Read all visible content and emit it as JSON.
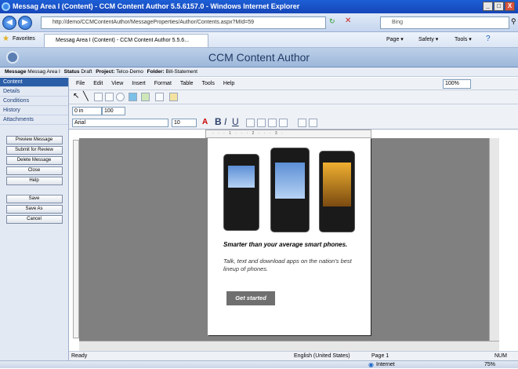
{
  "window": {
    "title": "Messag Area I (Content) - CCM Content Author 5.5.6157.0 - Windows Internet Explorer",
    "min": "_",
    "max": "□",
    "close": "X"
  },
  "browser": {
    "url": "http://demo/CCMContentAuthor/MessageProperties/Author/Contents.aspx?MId=59",
    "search_placeholder": "Bing",
    "favorites": "Favorites",
    "tab": "Messag Area I (Content) - CCM Content Author 5.5.6...",
    "page_menu": "Page ▾",
    "safety_menu": "Safety ▾",
    "tools_menu": "Tools ▾"
  },
  "app": {
    "title": "CCM Content Author"
  },
  "info": {
    "message_label": "Message",
    "message_value": "Messag Area I",
    "status_label": "Status",
    "status_value": "Draft",
    "project_label": "Project:",
    "project_value": "Telco-Demo",
    "folder_label": "Folder:",
    "folder_value": "Bill-Statement"
  },
  "sidebar": {
    "nav": [
      "Content",
      "Details",
      "Conditions",
      "History",
      "Attachments"
    ],
    "actions": [
      "Preview Message",
      "Submit for Review",
      "Delete Message",
      "Close",
      "Help"
    ],
    "save": [
      "Save",
      "Save As",
      "Cancel"
    ]
  },
  "menu": [
    "File",
    "Edit",
    "View",
    "Insert",
    "Format",
    "Table",
    "Tools",
    "Help"
  ],
  "toolbar": {
    "zoom": "100%",
    "font": "Arial",
    "size": "10",
    "indent": "0 in",
    "spacing": "100"
  },
  "ruler": "· · · 1 · · · 2 · · · 3 ·",
  "doc": {
    "headline": "Smarter than your average smart phones.",
    "body": "Talk, text and download apps on the nation's best lineup of phones.",
    "cta": "Get started"
  },
  "status": {
    "ready": "Ready",
    "language": "English (United States)",
    "page": "Page 1",
    "num": "NUM"
  },
  "ie_status": {
    "zone": "Internet",
    "zoom": "75%"
  }
}
